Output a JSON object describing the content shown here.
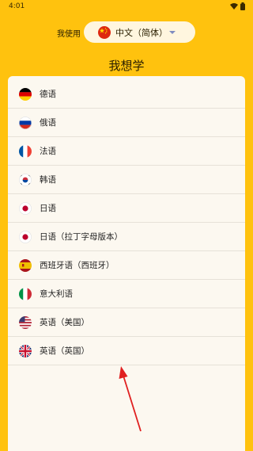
{
  "status_bar": {
    "time": "4:01"
  },
  "header": {
    "i_use_label": "我使用",
    "selected_language": "中文（简体）"
  },
  "heading": "我想学",
  "languages": [
    {
      "label": "德语",
      "flag": "germany-flag-icon"
    },
    {
      "label": "俄语",
      "flag": "russia-flag-icon"
    },
    {
      "label": "法语",
      "flag": "france-flag-icon"
    },
    {
      "label": "韩语",
      "flag": "korea-flag-icon"
    },
    {
      "label": "日语",
      "flag": "japan-flag-icon"
    },
    {
      "label": "日语（拉丁字母版本）",
      "flag": "japan-flag-icon"
    },
    {
      "label": "西班牙语（西班牙）",
      "flag": "spain-flag-icon"
    },
    {
      "label": "意大利语",
      "flag": "italy-flag-icon"
    },
    {
      "label": "英语（美国）",
      "flag": "usa-flag-icon"
    },
    {
      "label": "英语（英国）",
      "flag": "uk-flag-icon"
    }
  ],
  "colors": {
    "background": "#FFC20E",
    "card": "#FCF8F0",
    "arrow": "#E02020"
  }
}
